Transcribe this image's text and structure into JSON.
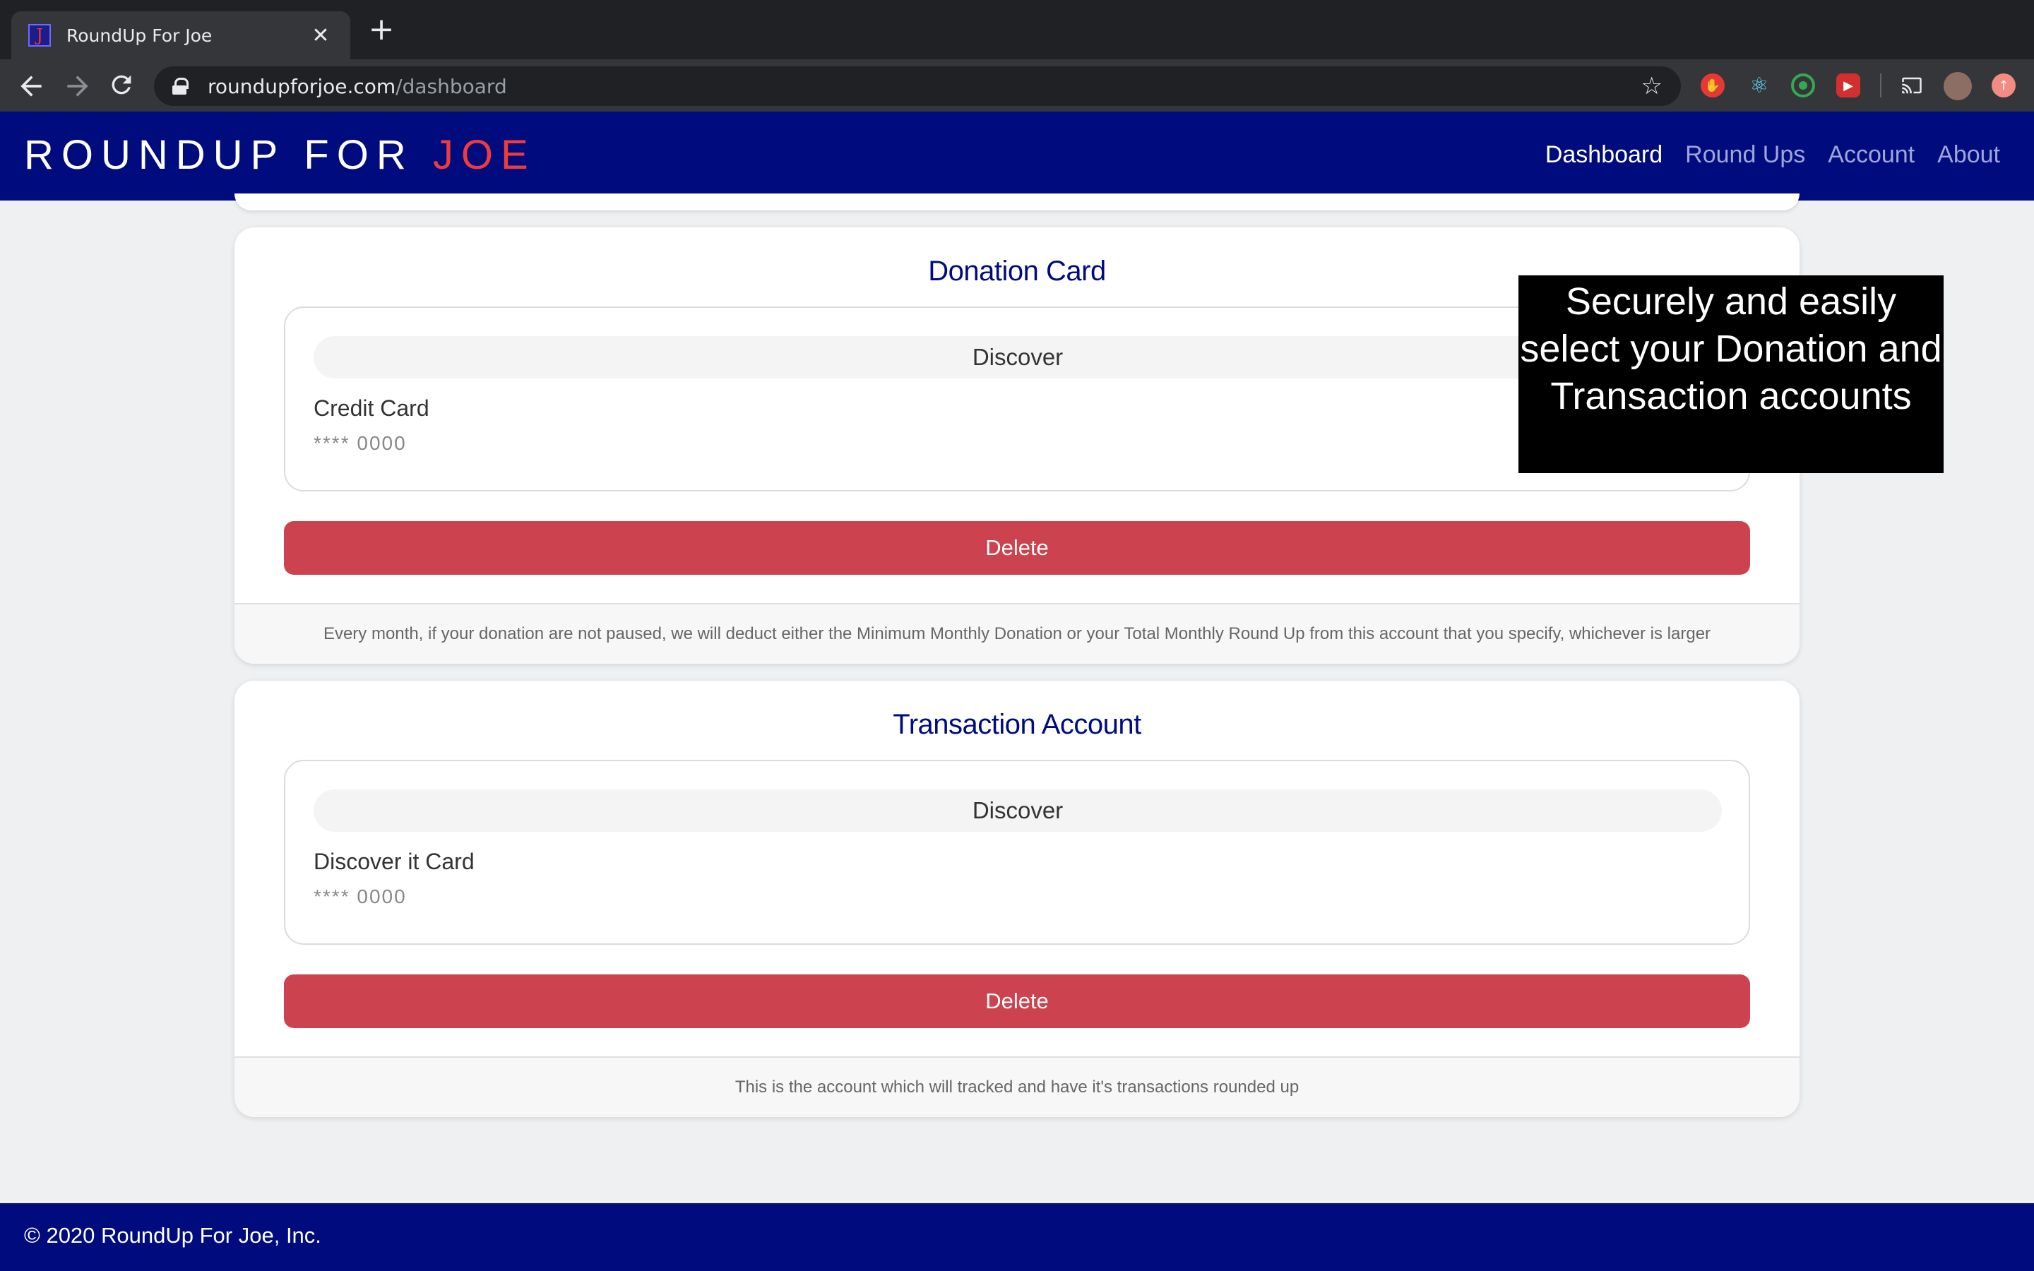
{
  "browser": {
    "tab_title": "RoundUp For Joe",
    "tab_favicon": "J",
    "close_glyph": "✕",
    "new_tab_glyph": "+",
    "url_domain": "roundupforjoe.com",
    "url_path": "/dashboard"
  },
  "navbar": {
    "brand_main": "ROUNDUP FOR ",
    "brand_accent": "JOE",
    "links": [
      {
        "label": "Dashboard"
      },
      {
        "label": "Round Ups"
      },
      {
        "label": "Account"
      },
      {
        "label": "About"
      }
    ]
  },
  "donation_card": {
    "title": "Donation Card",
    "institution": "Discover",
    "account_name": "Credit Card",
    "mask": "**** 0000",
    "delete_label": "Delete",
    "footer": "Every month, if your donation are not paused, we will deduct either the Minimum Monthly Donation or your Total Monthly Round Up from this account that you specify, whichever is larger"
  },
  "transaction_card": {
    "title": "Transaction Account",
    "institution": "Discover",
    "account_name": "Discover it Card",
    "mask": "**** 0000",
    "delete_label": "Delete",
    "footer": "This is the account which will tracked and have it's transactions rounded up"
  },
  "callout": {
    "text": "Securely and easily select your Donation and Transaction accounts"
  },
  "footer": {
    "text": "© 2020 RoundUp For Joe, Inc."
  },
  "colors": {
    "brand_navy": "#000c7e",
    "accent_red": "#ee3b3b",
    "delete_red": "#cc424e"
  }
}
